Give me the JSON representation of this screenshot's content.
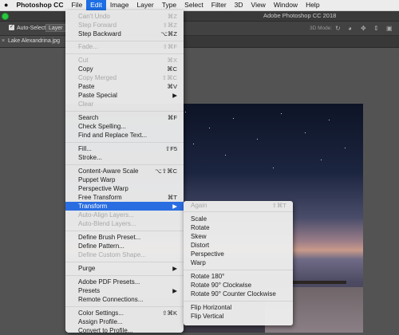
{
  "menubar": {
    "apple": "",
    "items": [
      "Photoshop CC",
      "File",
      "Edit",
      "Image",
      "Layer",
      "Type",
      "Select",
      "Filter",
      "3D",
      "View",
      "Window",
      "Help"
    ],
    "active_index": 2
  },
  "window": {
    "title": "Adobe Photoshop CC 2018"
  },
  "options_bar": {
    "auto_select_label": "Auto-Select:",
    "auto_select_value": "Layer",
    "mode_3d_label": "3D Mode:"
  },
  "document_tab": {
    "name": "Lake Alexandrina.jpg @"
  },
  "edit_menu": {
    "items": [
      {
        "label": "Can't Undo",
        "shortcut": "⌘Z",
        "disabled": true
      },
      {
        "label": "Step Forward",
        "shortcut": "⇧⌘Z",
        "disabled": true
      },
      {
        "label": "Step Backward",
        "shortcut": "⌥⌘Z",
        "disabled": false
      },
      {
        "label": "Fade...",
        "shortcut": "⇧⌘F",
        "disabled": true
      },
      {
        "label": "Cut",
        "shortcut": "⌘X",
        "disabled": true
      },
      {
        "label": "Copy",
        "shortcut": "⌘C",
        "disabled": false
      },
      {
        "label": "Copy Merged",
        "shortcut": "⇧⌘C",
        "disabled": true
      },
      {
        "label": "Paste",
        "shortcut": "⌘V",
        "disabled": false
      },
      {
        "label": "Paste Special",
        "shortcut": "▶",
        "disabled": false
      },
      {
        "label": "Clear",
        "shortcut": "",
        "disabled": true
      },
      {
        "label": "Search",
        "shortcut": "⌘F",
        "disabled": false
      },
      {
        "label": "Check Spelling...",
        "shortcut": "",
        "disabled": false
      },
      {
        "label": "Find and Replace Text...",
        "shortcut": "",
        "disabled": false
      },
      {
        "label": "Fill...",
        "shortcut": "⇧F5",
        "disabled": false
      },
      {
        "label": "Stroke...",
        "shortcut": "",
        "disabled": false
      },
      {
        "label": "Content-Aware Scale",
        "shortcut": "⌥⇧⌘C",
        "disabled": false
      },
      {
        "label": "Puppet Warp",
        "shortcut": "",
        "disabled": false
      },
      {
        "label": "Perspective Warp",
        "shortcut": "",
        "disabled": false
      },
      {
        "label": "Free Transform",
        "shortcut": "⌘T",
        "disabled": false
      },
      {
        "label": "Transform",
        "shortcut": "▶",
        "disabled": false,
        "highlighted": true
      },
      {
        "label": "Auto-Align Layers...",
        "shortcut": "",
        "disabled": true
      },
      {
        "label": "Auto-Blend Layers...",
        "shortcut": "",
        "disabled": true
      },
      {
        "label": "Define Brush Preset...",
        "shortcut": "",
        "disabled": false
      },
      {
        "label": "Define Pattern...",
        "shortcut": "",
        "disabled": false
      },
      {
        "label": "Define Custom Shape...",
        "shortcut": "",
        "disabled": true
      },
      {
        "label": "Purge",
        "shortcut": "▶",
        "disabled": false
      },
      {
        "label": "Adobe PDF Presets...",
        "shortcut": "",
        "disabled": false
      },
      {
        "label": "Presets",
        "shortcut": "▶",
        "disabled": false
      },
      {
        "label": "Remote Connections...",
        "shortcut": "",
        "disabled": false
      },
      {
        "label": "Color Settings...",
        "shortcut": "⇧⌘K",
        "disabled": false
      },
      {
        "label": "Assign Profile...",
        "shortcut": "",
        "disabled": false
      },
      {
        "label": "Convert to Profile...",
        "shortcut": "",
        "disabled": false
      }
    ]
  },
  "transform_submenu": {
    "items": [
      {
        "label": "Again",
        "shortcut": "⇧⌘T",
        "disabled": true
      },
      {
        "label": "Scale",
        "shortcut": "",
        "disabled": false
      },
      {
        "label": "Rotate",
        "shortcut": "",
        "disabled": false
      },
      {
        "label": "Skew",
        "shortcut": "",
        "disabled": false
      },
      {
        "label": "Distort",
        "shortcut": "",
        "disabled": false
      },
      {
        "label": "Perspective",
        "shortcut": "",
        "disabled": false
      },
      {
        "label": "Warp",
        "shortcut": "",
        "disabled": false
      },
      {
        "label": "Rotate 180°",
        "shortcut": "",
        "disabled": false
      },
      {
        "label": "Rotate 90° Clockwise",
        "shortcut": "",
        "disabled": false
      },
      {
        "label": "Rotate 90° Counter Clockwise",
        "shortcut": "",
        "disabled": false
      },
      {
        "label": "Flip Horizontal",
        "shortcut": "",
        "disabled": false
      },
      {
        "label": "Flip Vertical",
        "shortcut": "",
        "disabled": false
      }
    ]
  },
  "colors": {
    "highlight": "#2a6de1",
    "menu_bg": "#ececec",
    "disabled_text": "#a8a8a8"
  }
}
